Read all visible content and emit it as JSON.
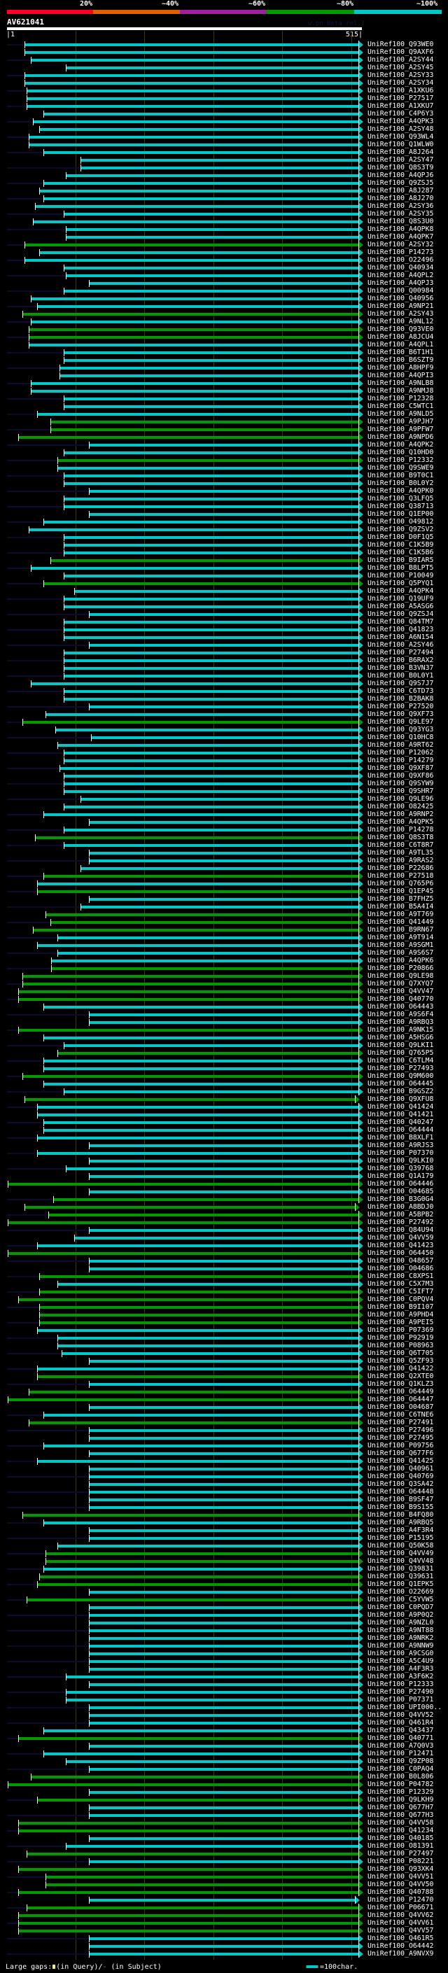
{
  "scale": {
    "labels": [
      "20%",
      "~40%",
      "~60%",
      "~80%",
      "~100%"
    ],
    "colors": [
      "#ff0022",
      "#e06000",
      "#a020a0",
      "#009900",
      "#00c8c8"
    ]
  },
  "title": "AV621041",
  "version_text": "w.pn Beta rel.7",
  "ruler": {
    "start": "|1",
    "end": "515|",
    "query_length": 515
  },
  "identity_colors": {
    "100": "#00c8c8",
    "80": "#009900"
  },
  "hits": [
    [
      "UniRef100_Q93WE0",
      27,
      100
    ],
    [
      "UniRef100_Q9AXF6",
      27,
      100
    ],
    [
      "UniRef100_A2SY44",
      36,
      100
    ],
    [
      "UniRef100_A2SY45",
      87,
      100
    ],
    [
      "UniRef100_A2SY33",
      27,
      100
    ],
    [
      "UniRef100_A2SY34",
      27,
      100
    ],
    [
      "UniRef100_A1XKU6",
      30,
      100
    ],
    [
      "UniRef100_P27517",
      30,
      100
    ],
    [
      "UniRef100_A1XKU7",
      30,
      100
    ],
    [
      "UniRef100_C4P6Y3",
      54,
      100
    ],
    [
      "UniRef100_A4QPK3",
      39,
      100
    ],
    [
      "UniRef100_A2SY48",
      48,
      100
    ],
    [
      "UniRef100_Q93WL4",
      33,
      100
    ],
    [
      "UniRef100_Q1WLW0",
      33,
      100
    ],
    [
      "UniRef100_A8J264",
      54,
      100
    ],
    [
      "UniRef100_A2SY47",
      108,
      100
    ],
    [
      "UniRef100_Q8S3T9",
      108,
      100
    ],
    [
      "UniRef100_A4QPJ6",
      87,
      100
    ],
    [
      "UniRef100_Q9ZSJ5",
      54,
      100
    ],
    [
      "UniRef100_A8J287",
      48,
      100
    ],
    [
      "UniRef100_A8J270",
      54,
      100
    ],
    [
      "UniRef100_A2SY36",
      42,
      100
    ],
    [
      "UniRef100_A2SY35",
      84,
      100
    ],
    [
      "UniRef100_Q8S3U0",
      39,
      100
    ],
    [
      "UniRef100_A4QPK8",
      87,
      100
    ],
    [
      "UniRef100_A4QPK7",
      87,
      100
    ],
    [
      "UniRef100_A2SY32",
      27,
      80
    ],
    [
      "UniRef100_P14273",
      48,
      100
    ],
    [
      "UniRef100_O22496",
      27,
      100
    ],
    [
      "UniRef100_Q40934",
      84,
      100
    ],
    [
      "UniRef100_A4QPL2",
      87,
      100
    ],
    [
      "UniRef100_A4QPJ3",
      121,
      100
    ],
    [
      "UniRef100_Q00984",
      84,
      100
    ],
    [
      "UniRef100_Q40956",
      36,
      100
    ],
    [
      "UniRef100_A9NP21",
      45,
      100
    ],
    [
      "UniRef100_A2SY43",
      24,
      80
    ],
    [
      "UniRef100_A9NL12",
      36,
      100
    ],
    [
      "UniRef100_Q93VE0",
      33,
      80
    ],
    [
      "UniRef100_A8JCU4",
      33,
      80
    ],
    [
      "UniRef100_A4QPL1",
      33,
      100
    ],
    [
      "UniRef100_B6T1H1",
      84,
      100
    ],
    [
      "UniRef100_B6SZT9",
      84,
      100
    ],
    [
      "UniRef100_A8HPF9",
      78,
      100
    ],
    [
      "UniRef100_A4QPI3",
      78,
      100
    ],
    [
      "UniRef100_A9NLB8",
      36,
      100
    ],
    [
      "UniRef100_A9NMJ8",
      36,
      100
    ],
    [
      "UniRef100_P12328",
      84,
      100
    ],
    [
      "UniRef100_C5WTC1",
      84,
      100
    ],
    [
      "UniRef100_A9NLD5",
      45,
      100
    ],
    [
      "UniRef100_A9PJH7",
      64,
      80
    ],
    [
      "UniRef100_A9PFW7",
      64,
      80
    ],
    [
      "UniRef100_A9NPD6",
      17,
      80
    ],
    [
      "UniRef100_A4QPK2",
      121,
      100
    ],
    [
      "UniRef100_Q10HD0",
      84,
      100
    ],
    [
      "UniRef100_P12332",
      75,
      80
    ],
    [
      "UniRef100_Q9SWE9",
      75,
      100
    ],
    [
      "UniRef100_B9T0C1",
      84,
      100
    ],
    [
      "UniRef100_B0L0Y2",
      84,
      100
    ],
    [
      "UniRef100_A4QPK0",
      121,
      100
    ],
    [
      "UniRef100_Q3LFQ5",
      84,
      100
    ],
    [
      "UniRef100_Q38713",
      84,
      100
    ],
    [
      "UniRef100_Q1EP00",
      121,
      100
    ],
    [
      "UniRef100_O49812",
      54,
      100
    ],
    [
      "UniRef100_Q9ZSV2",
      33,
      100
    ],
    [
      "UniRef100_D0F1Q5",
      84,
      100
    ],
    [
      "UniRef100_C1K5B9",
      84,
      100
    ],
    [
      "UniRef100_C1K5B6",
      84,
      100
    ],
    [
      "UniRef100_B9IAR5",
      64,
      80
    ],
    [
      "UniRef100_B8LPT5",
      36,
      100
    ],
    [
      "UniRef100_P10049",
      84,
      100
    ],
    [
      "UniRef100_Q5PYQ1",
      54,
      80
    ],
    [
      "UniRef100_A4QPK4",
      99,
      100
    ],
    [
      "UniRef100_Q19UF9",
      84,
      100
    ],
    [
      "UniRef100_A5ASG6",
      84,
      100
    ],
    [
      "UniRef100_Q9ZSJ4",
      121,
      100
    ],
    [
      "UniRef100_Q84TM7",
      84,
      100
    ],
    [
      "UniRef100_Q41823",
      84,
      100
    ],
    [
      "UniRef100_A6N154",
      84,
      100
    ],
    [
      "UniRef100_A2SY46",
      121,
      100
    ],
    [
      "UniRef100_P27494",
      84,
      100
    ],
    [
      "UniRef100_B6RAX2",
      84,
      100
    ],
    [
      "UniRef100_B3VN37",
      84,
      100
    ],
    [
      "UniRef100_B0L0Y1",
      84,
      100
    ],
    [
      "UniRef100_Q9S7J7",
      36,
      100
    ],
    [
      "UniRef100_C6TD73",
      84,
      100
    ],
    [
      "UniRef100_B2BAK8",
      84,
      100
    ],
    [
      "UniRef100_P27520",
      121,
      100
    ],
    [
      "UniRef100_Q9XF73",
      57,
      100
    ],
    [
      "UniRef100_Q9LE97",
      24,
      80
    ],
    [
      "UniRef100_Q93YG3",
      72,
      100
    ],
    [
      "UniRef100_Q10HC8",
      124,
      100
    ],
    [
      "UniRef100_A9RT62",
      75,
      100
    ],
    [
      "UniRef100_P12062",
      84,
      100
    ],
    [
      "UniRef100_P14279",
      84,
      100
    ],
    [
      "UniRef100_Q9XF87",
      78,
      100
    ],
    [
      "UniRef100_Q9XF86",
      84,
      100
    ],
    [
      "UniRef100_Q9SYW9",
      84,
      100
    ],
    [
      "UniRef100_Q9SHR7",
      84,
      100
    ],
    [
      "UniRef100_Q9LE96",
      108,
      100
    ],
    [
      "UniRef100_O82425",
      84,
      100
    ],
    [
      "UniRef100_A9RNP2",
      54,
      100
    ],
    [
      "UniRef100_A4QPK5",
      121,
      100
    ],
    [
      "UniRef100_P14278",
      84,
      100
    ],
    [
      "UniRef100_Q8S3T8",
      42,
      80
    ],
    [
      "UniRef100_C6T8R7",
      84,
      100
    ],
    [
      "UniRef100_A9TL35",
      121,
      100
    ],
    [
      "UniRef100_A9RAS2",
      121,
      100
    ],
    [
      "UniRef100_P22686",
      108,
      100
    ],
    [
      "UniRef100_P27518",
      54,
      80
    ],
    [
      "UniRef100_Q765P6",
      45,
      100
    ],
    [
      "UniRef100_Q1EP45",
      45,
      80
    ],
    [
      "UniRef100_B7FHZ5",
      121,
      100
    ],
    [
      "UniRef100_B5A4I4",
      108,
      100
    ],
    [
      "UniRef100_A9T769",
      57,
      80
    ],
    [
      "UniRef100_Q41449",
      64,
      80
    ],
    [
      "UniRef100_B9RN67",
      39,
      80
    ],
    [
      "UniRef100_A9T914",
      75,
      100
    ],
    [
      "UniRef100_A9SGM1",
      45,
      100
    ],
    [
      "UniRef100_A9S6S7",
      75,
      100
    ],
    [
      "UniRef100_A4QPK6",
      66,
      100
    ],
    [
      "UniRef100_P20866",
      66,
      80
    ],
    [
      "UniRef100_Q9LE98",
      24,
      80
    ],
    [
      "UniRef100_Q7XYQ7",
      24,
      80
    ],
    [
      "UniRef100_Q4VV47",
      17,
      80
    ],
    [
      "UniRef100_Q40770",
      17,
      80
    ],
    [
      "UniRef100_O64443",
      54,
      100
    ],
    [
      "UniRef100_A9S6F4",
      121,
      100
    ],
    [
      "UniRef100_A9RBQ3",
      121,
      100
    ],
    [
      "UniRef100_A9NK15",
      17,
      80
    ],
    [
      "UniRef100_A5HSG6",
      54,
      100
    ],
    [
      "UniRef100_Q9LKI1",
      84,
      100
    ],
    [
      "UniRef100_Q765P5",
      75,
      80
    ],
    [
      "UniRef100_C6TLM4",
      54,
      100
    ],
    [
      "UniRef100_P27493",
      54,
      100
    ],
    [
      "UniRef100_Q9M600",
      24,
      80
    ],
    [
      "UniRef100_O64445",
      54,
      100
    ],
    [
      "UniRef100_B9GSZ2",
      84,
      100
    ],
    [
      "UniRef100_Q9XFU8",
      27,
      80
    ],
    [
      "UniRef100_Q41424",
      45,
      100
    ],
    [
      "UniRef100_Q41421",
      45,
      100
    ],
    [
      "UniRef100_Q40247",
      54,
      100
    ],
    [
      "UniRef100_O64444",
      54,
      100
    ],
    [
      "UniRef100_B8XLF1",
      45,
      100
    ],
    [
      "UniRef100_A9RJS3",
      121,
      100
    ],
    [
      "UniRef100_P07370",
      45,
      100
    ],
    [
      "UniRef100_Q9LKI0",
      121,
      100
    ],
    [
      "UniRef100_Q39768",
      87,
      100
    ],
    [
      "UniRef100_Q1A179",
      121,
      100
    ],
    [
      "UniRef100_O64446",
      2,
      80
    ],
    [
      "UniRef100_O04685",
      121,
      100
    ],
    [
      "UniRef100_B3G0G4",
      69,
      80
    ],
    [
      "UniRef100_A8BDJ0",
      27,
      80
    ],
    [
      "UniRef100_A5BPB2",
      61,
      80
    ],
    [
      "UniRef100_P27492",
      2,
      80
    ],
    [
      "UniRef100_Q84U94",
      121,
      100
    ],
    [
      "UniRef100_Q4VV59",
      99,
      100
    ],
    [
      "UniRef100_Q41423",
      45,
      100
    ],
    [
      "UniRef100_O64450",
      2,
      80
    ],
    [
      "UniRef100_O48657",
      121,
      100
    ],
    [
      "UniRef100_O04686",
      121,
      100
    ],
    [
      "UniRef100_C8XPS1",
      48,
      80
    ],
    [
      "UniRef100_C5X7M3",
      75,
      100
    ],
    [
      "UniRef100_C5IFT7",
      48,
      80
    ],
    [
      "UniRef100_C0PQV4",
      17,
      80
    ],
    [
      "UniRef100_B9I107",
      48,
      80
    ],
    [
      "UniRef100_A9PHD4",
      48,
      80
    ],
    [
      "UniRef100_A9PEI5",
      48,
      80
    ],
    [
      "UniRef100_P07369",
      45,
      100
    ],
    [
      "UniRef100_P92919",
      75,
      100
    ],
    [
      "UniRef100_P08963",
      75,
      100
    ],
    [
      "UniRef100_Q6T705",
      81,
      100
    ],
    [
      "UniRef100_Q5ZF93",
      121,
      100
    ],
    [
      "UniRef100_Q41422",
      45,
      100
    ],
    [
      "UniRef100_Q2XTE0",
      45,
      80
    ],
    [
      "UniRef100_Q1KLZ3",
      121,
      100
    ],
    [
      "UniRef100_O64449",
      33,
      80
    ],
    [
      "UniRef100_O64447",
      2,
      80
    ],
    [
      "UniRef100_O04687",
      121,
      100
    ],
    [
      "UniRef100_C6TNE6",
      54,
      100
    ],
    [
      "UniRef100_P27491",
      33,
      80
    ],
    [
      "UniRef100_P27496",
      121,
      100
    ],
    [
      "UniRef100_P27495",
      121,
      100
    ],
    [
      "UniRef100_P09756",
      54,
      100
    ],
    [
      "UniRef100_Q677F6",
      121,
      100
    ],
    [
      "UniRef100_Q41425",
      45,
      100
    ],
    [
      "UniRef100_Q40961",
      121,
      100
    ],
    [
      "UniRef100_Q40769",
      121,
      100
    ],
    [
      "UniRef100_Q3SA42",
      121,
      100
    ],
    [
      "UniRef100_O64448",
      121,
      100
    ],
    [
      "UniRef100_B9SF47",
      121,
      100
    ],
    [
      "UniRef100_B9S155",
      121,
      100
    ],
    [
      "UniRef100_B4FQ80",
      24,
      80
    ],
    [
      "UniRef100_A9RBQ5",
      54,
      100
    ],
    [
      "UniRef100_A4F3R4",
      121,
      100
    ],
    [
      "UniRef100_P15195",
      121,
      100
    ],
    [
      "UniRef100_Q50K58",
      75,
      100
    ],
    [
      "UniRef100_Q4VV49",
      57,
      80
    ],
    [
      "UniRef100_Q4VV48",
      57,
      80
    ],
    [
      "UniRef100_Q39831",
      54,
      100
    ],
    [
      "UniRef100_Q39631",
      48,
      80
    ],
    [
      "UniRef100_Q1EPK5",
      45,
      80
    ],
    [
      "UniRef100_O22669",
      121,
      100
    ],
    [
      "UniRef100_C5YVW5",
      30,
      80
    ],
    [
      "UniRef100_C0PQD7",
      121,
      100
    ],
    [
      "UniRef100_A9P0Q2",
      121,
      100
    ],
    [
      "UniRef100_A9NZL0",
      121,
      100
    ],
    [
      "UniRef100_A9NT88",
      121,
      100
    ],
    [
      "UniRef100_A9NRK2",
      121,
      100
    ],
    [
      "UniRef100_A9NNW9",
      121,
      100
    ],
    [
      "UniRef100_A9CSG0",
      121,
      100
    ],
    [
      "UniRef100_A5C4U9",
      121,
      100
    ],
    [
      "UniRef100_A4F3R3",
      121,
      100
    ],
    [
      "UniRef100_A3F6K2",
      87,
      100
    ],
    [
      "UniRef100_P12333",
      121,
      100
    ],
    [
      "UniRef100_P27490",
      87,
      100
    ],
    [
      "UniRef100_P07371",
      87,
      100
    ],
    [
      "UniRef100_UPI000..",
      121,
      100
    ],
    [
      "UniRef100_Q4VV52",
      121,
      100
    ],
    [
      "UniRef100_Q461R4",
      121,
      100
    ],
    [
      "UniRef100_Q43437",
      54,
      100
    ],
    [
      "UniRef100_Q40771",
      17,
      80
    ],
    [
      "UniRef100_A7Q0V3",
      121,
      100
    ],
    [
      "UniRef100_P12471",
      54,
      100
    ],
    [
      "UniRef100_Q9ZP08",
      87,
      100
    ],
    [
      "UniRef100_C0PAQ4",
      121,
      100
    ],
    [
      "UniRef100_B0L806",
      36,
      80
    ],
    [
      "UniRef100_P04782",
      2,
      80
    ],
    [
      "UniRef100_P12329",
      121,
      100
    ],
    [
      "UniRef100_Q9LKH9",
      45,
      80
    ],
    [
      "UniRef100_Q677H7",
      121,
      100
    ],
    [
      "UniRef100_Q677H3",
      121,
      100
    ],
    [
      "UniRef100_Q4VV58",
      17,
      80
    ],
    [
      "UniRef100_Q41234",
      17,
      80
    ],
    [
      "UniRef100_Q40185",
      121,
      100
    ],
    [
      "UniRef100_O81391",
      87,
      100
    ],
    [
      "UniRef100_P27497",
      30,
      80
    ],
    [
      "UniRef100_P08221",
      121,
      100
    ],
    [
      "UniRef100_Q93XK4",
      17,
      80
    ],
    [
      "UniRef100_Q4VV51",
      57,
      80
    ],
    [
      "UniRef100_Q4VV50",
      57,
      80
    ],
    [
      "UniRef100_Q40788",
      17,
      80
    ],
    [
      "UniRef100_P12470",
      121,
      100
    ],
    [
      "UniRef100_P06671",
      30,
      80
    ],
    [
      "UniRef100_Q4VV62",
      17,
      80
    ],
    [
      "UniRef100_Q4VV61",
      17,
      80
    ],
    [
      "UniRef100_Q4VV57",
      17,
      80
    ],
    [
      "UniRef100_Q461R5",
      121,
      100
    ],
    [
      "UniRef100_O64442",
      121,
      100
    ],
    [
      "UniRef100_A9NVX9",
      121,
      100
    ]
  ],
  "short_end_rows": [
    138,
    152,
    242
  ],
  "footer": {
    "large_gaps_label": "Large gaps:",
    "query_text": "(in Query)/",
    "subject_dash": "-",
    "subject_text": " (in Subject)",
    "legend_text": "=100char."
  }
}
